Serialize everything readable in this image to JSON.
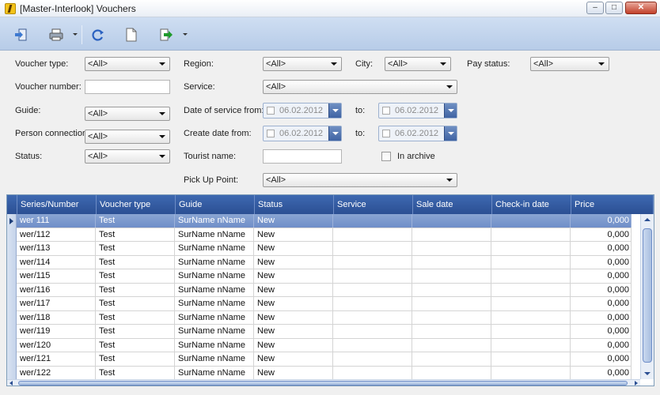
{
  "window": {
    "title": "[Master-Interlook] Vouchers",
    "minimize_glyph": "–",
    "maximize_glyph": "□",
    "close_glyph": "✕"
  },
  "toolbar": {
    "icons": [
      "exit-icon",
      "print-icon",
      "refresh-icon",
      "new-document-icon",
      "export-icon"
    ]
  },
  "filters": {
    "voucher_type": {
      "label": "Voucher type:",
      "value": "<All>"
    },
    "voucher_number": {
      "label": "Voucher number:",
      "value": ""
    },
    "guide": {
      "label": "Guide:",
      "value": "<All>"
    },
    "person_connection": {
      "label": "Person connection:",
      "value": "<All>"
    },
    "status": {
      "label": "Status:",
      "value": "<All>"
    },
    "region": {
      "label": "Region:",
      "value": "<All>"
    },
    "service": {
      "label": "Service:",
      "value": "<All>"
    },
    "date_of_service_from": {
      "label": "Date of service from:",
      "value": "06.02.2012"
    },
    "date_of_service_to": {
      "label": "to:",
      "value": "06.02.2012"
    },
    "create_date_from": {
      "label": "Create date from:",
      "value": "06.02.2012"
    },
    "create_date_to": {
      "label": "to:",
      "value": "06.02.2012"
    },
    "tourist_name": {
      "label": "Tourist name:",
      "value": ""
    },
    "pick_up_point": {
      "label": "Pick Up Point:",
      "value": "<All>"
    },
    "city": {
      "label": "City:",
      "value": "<All>"
    },
    "in_archive": {
      "label": "In archive",
      "checked": false
    },
    "pay_status": {
      "label": "Pay status:",
      "value": "<All>"
    }
  },
  "grid": {
    "columns": [
      "Series/Number",
      "Voucher type",
      "Guide",
      "Status",
      "Service",
      "Sale date",
      "Check-in date",
      "Price"
    ],
    "rows": [
      [
        "wer 111",
        "Test",
        "SurName nName",
        "New",
        "",
        "",
        "",
        "0,000"
      ],
      [
        "wer/112",
        "Test",
        "SurName nName",
        "New",
        "",
        "",
        "",
        "0,000"
      ],
      [
        "wer/113",
        "Test",
        "SurName nName",
        "New",
        "",
        "",
        "",
        "0,000"
      ],
      [
        "wer/114",
        "Test",
        "SurName nName",
        "New",
        "",
        "",
        "",
        "0,000"
      ],
      [
        "wer/115",
        "Test",
        "SurName nName",
        "New",
        "",
        "",
        "",
        "0,000"
      ],
      [
        "wer/116",
        "Test",
        "SurName nName",
        "New",
        "",
        "",
        "",
        "0,000"
      ],
      [
        "wer/117",
        "Test",
        "SurName nName",
        "New",
        "",
        "",
        "",
        "0,000"
      ],
      [
        "wer/118",
        "Test",
        "SurName nName",
        "New",
        "",
        "",
        "",
        "0,000"
      ],
      [
        "wer/119",
        "Test",
        "SurName nName",
        "New",
        "",
        "",
        "",
        "0,000"
      ],
      [
        "wer/120",
        "Test",
        "SurName nName",
        "New",
        "",
        "",
        "",
        "0,000"
      ],
      [
        "wer/121",
        "Test",
        "SurName nName",
        "New",
        "",
        "",
        "",
        "0,000"
      ],
      [
        "wer/122",
        "Test",
        "SurName nName",
        "New",
        "",
        "",
        "",
        "0,000"
      ]
    ],
    "selected_row": 0
  },
  "colors": {
    "header": "#2b4f93",
    "selection": "#7d99cc",
    "toolbar": "#c3d5ee"
  }
}
